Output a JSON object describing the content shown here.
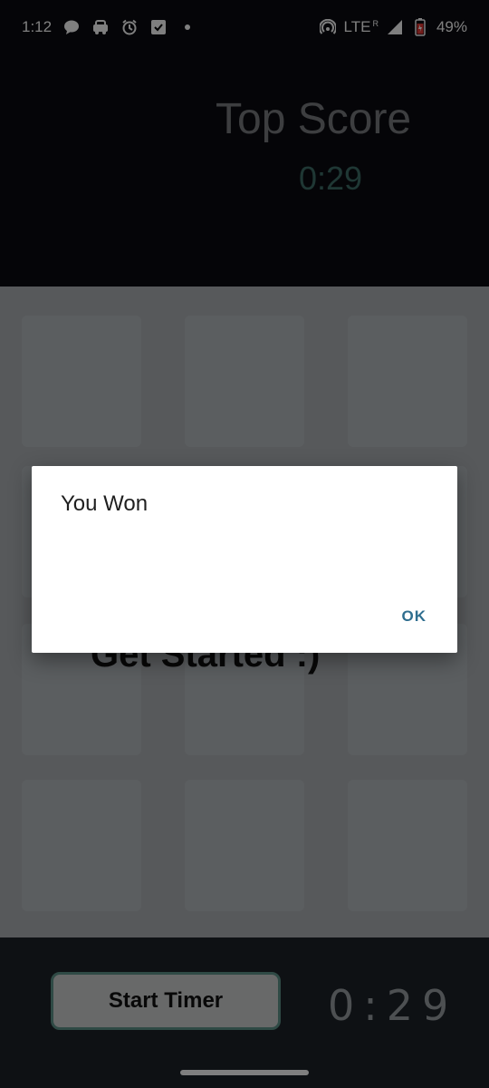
{
  "status_bar": {
    "time": "1:12",
    "network": "LTE",
    "roaming": "R",
    "battery": "49%",
    "icons": [
      "chat-icon",
      "car-icon",
      "alarm-icon",
      "check-icon",
      "dot-icon",
      "hotspot-icon",
      "signal-icon",
      "battery-icon"
    ]
  },
  "header": {
    "top_score_label": "Top Score",
    "top_score_value": "0:29"
  },
  "board": {
    "message": "Get Started :)"
  },
  "bottom_bar": {
    "start_button_label": "Start Timer",
    "timer": "0:29"
  },
  "dialog": {
    "title": "You Won",
    "ok_label": "OK"
  },
  "colors": {
    "header_bg": "#0a0b10",
    "accent_teal": "#5f958b",
    "dialog_button": "#2f6e8f"
  }
}
